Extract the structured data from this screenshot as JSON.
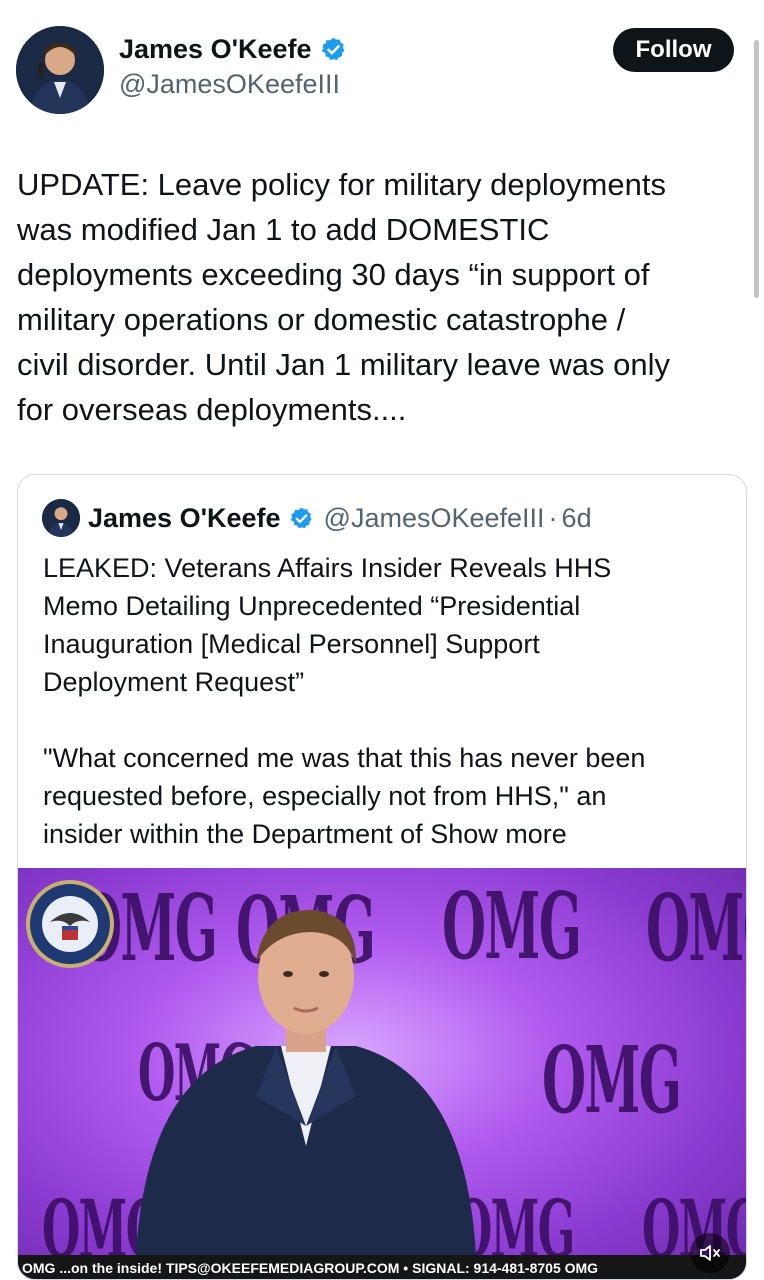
{
  "header": {
    "name": "James O'Keefe",
    "handle": "@JamesOKeefeIII",
    "follow_label": "Follow"
  },
  "tweet": {
    "lines": [
      "UPDATE: Leave policy for military deployments",
      "was modified Jan 1 to add DOMESTIC",
      "deployments exceeding 30 days “in support of",
      "military operations or domestic catastrophe /",
      "civil disorder.  Until Jan 1 military leave was only",
      "for overseas deployments...."
    ]
  },
  "quote": {
    "name": "James O'Keefe",
    "handle": "@JamesOKeefeIII",
    "separator": "·",
    "time": "6d",
    "text_lines": [
      "LEAKED: Veterans Affairs Insider Reveals HHS",
      "Memo Detailing Unprecedented “Presidential",
      "Inauguration [Medical Personnel] Support",
      "Deployment Request”"
    ],
    "text_lines_2": [
      "\"What concerned me was that this has never been",
      "requested before, especially not from HHS,\" an",
      "insider within the Department of "
    ],
    "show_more": "Show more",
    "media": {
      "backdrop_logo": "OMG",
      "ticker": "OMG  ...on the inside!  TIPS@OKEEFEMEDIAGROUP.COM  •  SIGNAL: 914-481-8705  OMG",
      "mute_icon": "speaker-muted-icon"
    }
  },
  "colors": {
    "text": "#0f1419",
    "secondary": "#536471",
    "verified": "#1d9bf0",
    "border": "#cfd9de",
    "media_purple": "#b25cf0"
  }
}
